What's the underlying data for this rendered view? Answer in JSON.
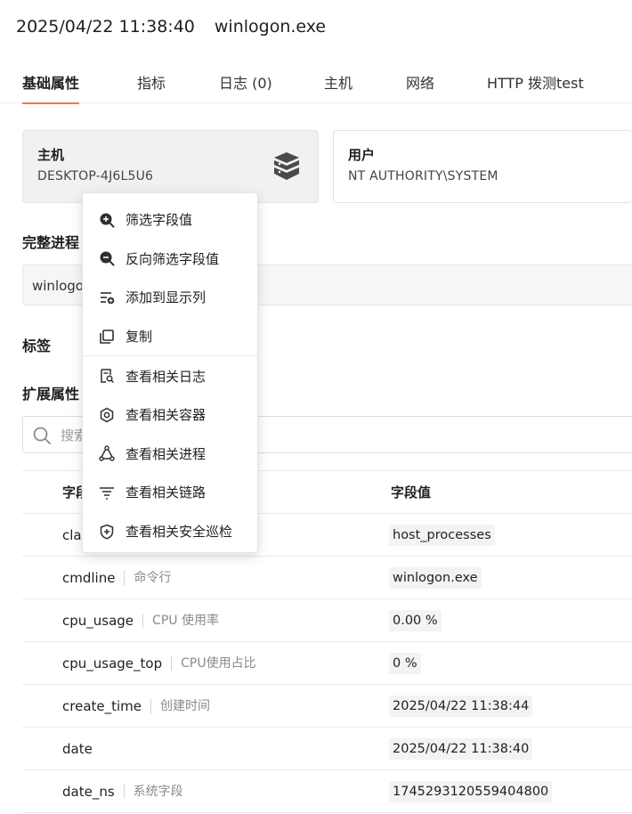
{
  "header": {
    "timestamp": "2025/04/22 11:38:40",
    "process": "winlogon.exe"
  },
  "tabs": [
    {
      "label": "基础属性",
      "active": true
    },
    {
      "label": "指标"
    },
    {
      "label": "日志 (0)"
    },
    {
      "label": "主机"
    },
    {
      "label": "网络"
    },
    {
      "label": "HTTP 拨测test"
    }
  ],
  "cards": {
    "host": {
      "label": "主机",
      "value": "DESKTOP-4J6L5U6",
      "icon": "database-server-icon"
    },
    "user": {
      "label": "用户",
      "value": "NT AUTHORITY\\SYSTEM"
    }
  },
  "sections": {
    "full_process": "完整进程",
    "full_process_value": "winlogo",
    "tags": "标签",
    "ext_attrs": "扩展属性"
  },
  "search": {
    "placeholder": "搜索"
  },
  "table": {
    "header": {
      "field": "字段",
      "value": "字段值"
    },
    "rows": [
      {
        "field": "cla",
        "zh": "",
        "value": "host_processes"
      },
      {
        "field": "cmdline",
        "zh": "命令行",
        "value": "winlogon.exe"
      },
      {
        "field": "cpu_usage",
        "zh": "CPU 使用率",
        "value": "0.00 %"
      },
      {
        "field": "cpu_usage_top",
        "zh": "CPU使用占比",
        "value": "0 %"
      },
      {
        "field": "create_time",
        "zh": "创建时间",
        "value": "2025/04/22 11:38:44"
      },
      {
        "field": "date",
        "zh": "",
        "value": "2025/04/22 11:38:40"
      },
      {
        "field": "date_ns",
        "zh": "系统字段",
        "value": "1745293120559404800"
      }
    ]
  },
  "context_menu": {
    "items": [
      {
        "label": "筛选字段值",
        "icon": "zoom-in-icon"
      },
      {
        "label": "反向筛选字段值",
        "icon": "zoom-out-icon"
      },
      {
        "label": "添加到显示列",
        "icon": "add-column-icon"
      },
      {
        "label": "复制",
        "icon": "copy-icon"
      },
      {
        "label": "查看相关日志",
        "icon": "log-search-icon"
      },
      {
        "label": "查看相关容器",
        "icon": "container-icon"
      },
      {
        "label": "查看相关进程",
        "icon": "process-icon"
      },
      {
        "label": "查看相关链路",
        "icon": "trace-icon"
      },
      {
        "label": "查看相关安全巡检",
        "icon": "shield-icon"
      }
    ]
  },
  "colors": {
    "accent": "#f27a3a"
  }
}
